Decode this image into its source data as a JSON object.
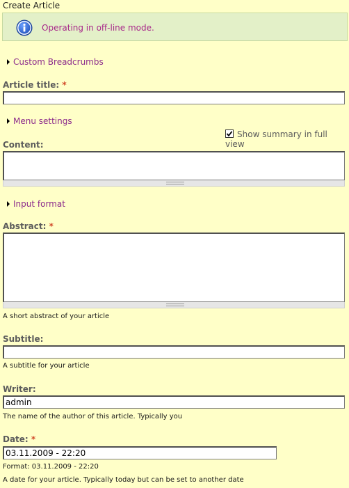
{
  "page": {
    "title": "Create Article"
  },
  "status": {
    "icon": "info-icon",
    "message": "Operating in off-line mode."
  },
  "links": {
    "custom_breadcrumbs": "Custom Breadcrumbs",
    "menu_settings": "Menu settings",
    "input_format": "Input format"
  },
  "fields": {
    "title": {
      "label": "Article title:",
      "required": "*",
      "value": ""
    },
    "show_summary": {
      "label": "Show summary in full view",
      "checked": true
    },
    "content": {
      "label": "Content:"
    },
    "abstract": {
      "label": "Abstract:",
      "required": "*",
      "description": "A short abstract of your article"
    },
    "subtitle": {
      "label": "Subtitle:",
      "value": "",
      "description": "A subtitle for your article"
    },
    "writer": {
      "label": "Writer:",
      "value": "admin",
      "description": "The name of the author of this article. Typically you"
    },
    "date": {
      "label": "Date:",
      "required": "*",
      "value": "03.11.2009 - 22:20",
      "format": "Format: 03.11.2009 - 22:20",
      "description": "A date for your article. Typically today but can be set to another date"
    }
  },
  "colors": {
    "background": "#ffffc8",
    "status_background": "#e3f0c8",
    "link": "#8b2a8b",
    "required": "#d24b2a"
  }
}
